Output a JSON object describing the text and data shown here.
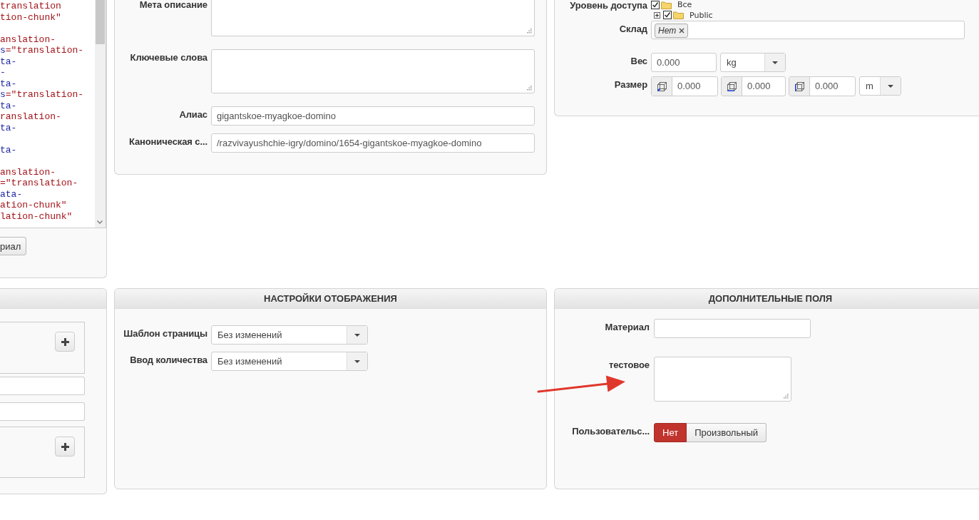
{
  "code_panel": {
    "lines": [
      {
        "kind": "code",
        "parts": [
          {
            "text": "translation",
            "kind": "value"
          }
        ]
      },
      {
        "kind": "code",
        "parts": [
          {
            "text": "tion-chunk\"",
            "kind": "value"
          }
        ]
      },
      {
        "kind": "blank"
      },
      {
        "kind": "code",
        "parts": [
          {
            "text": "anslation-",
            "kind": "value"
          }
        ]
      },
      {
        "kind": "code",
        "parts": [
          {
            "text": "s",
            "kind": "attr"
          },
          {
            "text": "=\"translation-",
            "kind": "value"
          }
        ]
      },
      {
        "kind": "code",
        "parts": [
          {
            "text": "ta-",
            "kind": "attr"
          }
        ]
      },
      {
        "kind": "code",
        "parts": [
          {
            "text": "-",
            "kind": "attr"
          }
        ]
      },
      {
        "kind": "code",
        "parts": [
          {
            "text": "ta-",
            "kind": "attr"
          }
        ]
      },
      {
        "kind": "code",
        "parts": [
          {
            "text": "s",
            "kind": "attr"
          },
          {
            "text": "=\"translation-",
            "kind": "value"
          }
        ]
      },
      {
        "kind": "code",
        "parts": [
          {
            "text": "ta-",
            "kind": "attr"
          }
        ]
      },
      {
        "kind": "code",
        "parts": [
          {
            "text": "ranslation-",
            "kind": "value"
          }
        ]
      },
      {
        "kind": "code",
        "parts": [
          {
            "text": "ta-",
            "kind": "attr"
          }
        ]
      },
      {
        "kind": "blank"
      },
      {
        "kind": "code",
        "parts": [
          {
            "text": "ta-",
            "kind": "attr"
          }
        ]
      },
      {
        "kind": "blank"
      },
      {
        "kind": "code",
        "parts": [
          {
            "text": "anslation-",
            "kind": "value"
          }
        ]
      },
      {
        "kind": "code",
        "parts": [
          {
            "text": "=\"translation-",
            "kind": "value"
          }
        ]
      },
      {
        "kind": "code",
        "parts": [
          {
            "text": "ata-",
            "kind": "attr"
          }
        ]
      },
      {
        "kind": "code",
        "parts": [
          {
            "text": "ation-chunk\"",
            "kind": "value"
          }
        ]
      },
      {
        "kind": "code",
        "parts": [
          {
            "text": "lation-chunk\"",
            "kind": "value"
          }
        ]
      }
    ],
    "button": "риал"
  },
  "seo_panel": {
    "fields": [
      {
        "label": "Мета описание",
        "kind": "textarea"
      },
      {
        "label": "Ключевые слова",
        "kind": "textarea"
      },
      {
        "label": "Алиас",
        "kind": "input",
        "value": "gigantskoe-myagkoe-domino"
      },
      {
        "label": "Каноническая с...",
        "kind": "input",
        "value": "/razvivayushchie-igry/domino/1654-gigantskoe-myagkoe-domino"
      }
    ]
  },
  "product_panel": {
    "access": {
      "label": "Уровень доступа",
      "tree": [
        {
          "label": "Все",
          "checked": true,
          "children": [
            {
              "label": "Public",
              "checked": true,
              "expanded": false
            }
          ]
        }
      ]
    },
    "warehouse": {
      "label": "Склад",
      "tags": [
        "Нет"
      ]
    },
    "weight": {
      "label": "Вес",
      "value": "0.000",
      "unit": "kg"
    },
    "size": {
      "label": "Размер",
      "values": [
        "0.000",
        "0.000",
        "0.000"
      ],
      "unit": "m"
    }
  },
  "list_panel": {
    "items": [
      {
        "kind": "box"
      },
      {
        "kind": "input"
      },
      {
        "kind": "input"
      },
      {
        "kind": "box"
      }
    ]
  },
  "display_panel": {
    "title": "НАСТРОЙКИ ОТОБРАЖЕНИЯ",
    "fields": [
      {
        "label": "Шаблон страницы",
        "value": "Без изменений"
      },
      {
        "label": "Ввод количества",
        "value": "Без изменений"
      }
    ]
  },
  "extra_panel": {
    "title": "ДОПОЛНИТЕЛЬНЫЕ ПОЛЯ",
    "fields": [
      {
        "label": "Материал",
        "kind": "input"
      },
      {
        "label": "тестовое",
        "kind": "textarea"
      },
      {
        "label": "Пользовательс...",
        "kind": "toggle",
        "options": [
          {
            "label": "Нет",
            "selected": true
          },
          {
            "label": "Произвольный",
            "selected": false
          }
        ]
      }
    ]
  }
}
